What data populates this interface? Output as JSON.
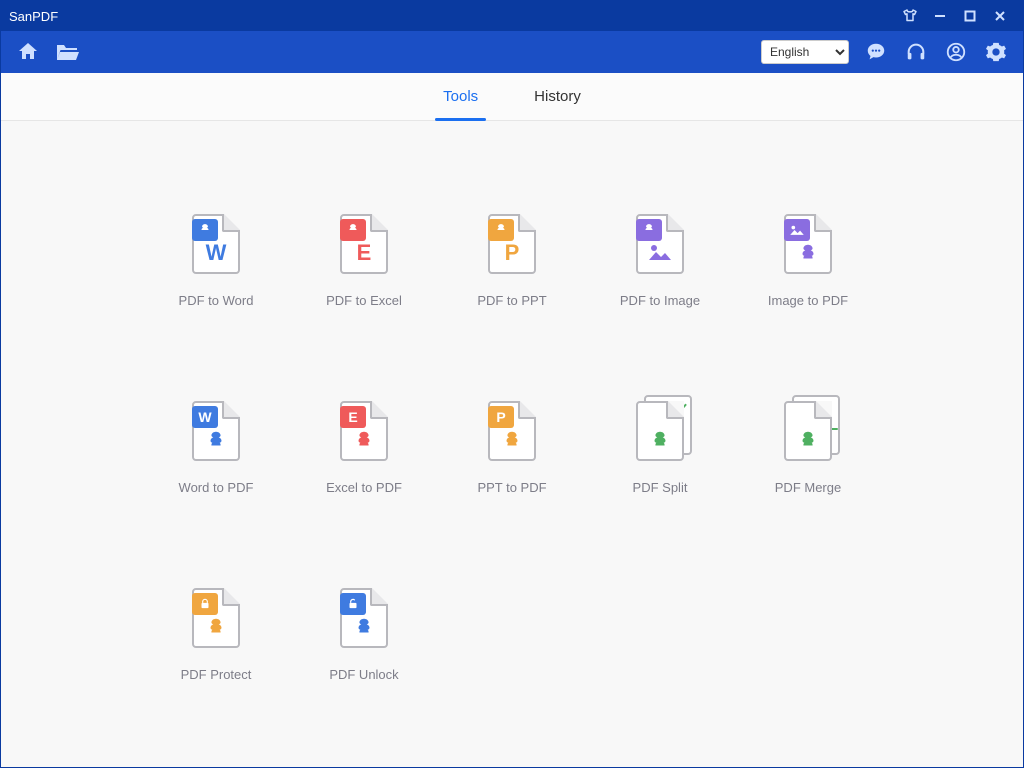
{
  "app": {
    "title": "SanPDF"
  },
  "toolbar": {
    "language": "English"
  },
  "tabs": {
    "tools": "Tools",
    "history": "History",
    "active": "tools"
  },
  "tools": [
    {
      "id": "pdf-to-word",
      "label": "PDF to Word"
    },
    {
      "id": "pdf-to-excel",
      "label": "PDF to Excel"
    },
    {
      "id": "pdf-to-ppt",
      "label": "PDF to PPT"
    },
    {
      "id": "pdf-to-image",
      "label": "PDF to Image"
    },
    {
      "id": "image-to-pdf",
      "label": "Image to PDF"
    },
    {
      "id": "word-to-pdf",
      "label": "Word to PDF"
    },
    {
      "id": "excel-to-pdf",
      "label": "Excel to PDF"
    },
    {
      "id": "ppt-to-pdf",
      "label": "PPT to PDF"
    },
    {
      "id": "pdf-split",
      "label": "PDF Split"
    },
    {
      "id": "pdf-merge",
      "label": "PDF Merge"
    },
    {
      "id": "pdf-protect",
      "label": "PDF Protect"
    },
    {
      "id": "pdf-unlock",
      "label": "PDF Unlock"
    }
  ],
  "colors": {
    "word": "#3f7be0",
    "excel": "#ef5a5a",
    "ppt": "#f0a63f",
    "image": "#8a6de0",
    "protect": "#f0a63f",
    "unlock": "#3f7be0",
    "splitmerge": "#4fb061"
  }
}
